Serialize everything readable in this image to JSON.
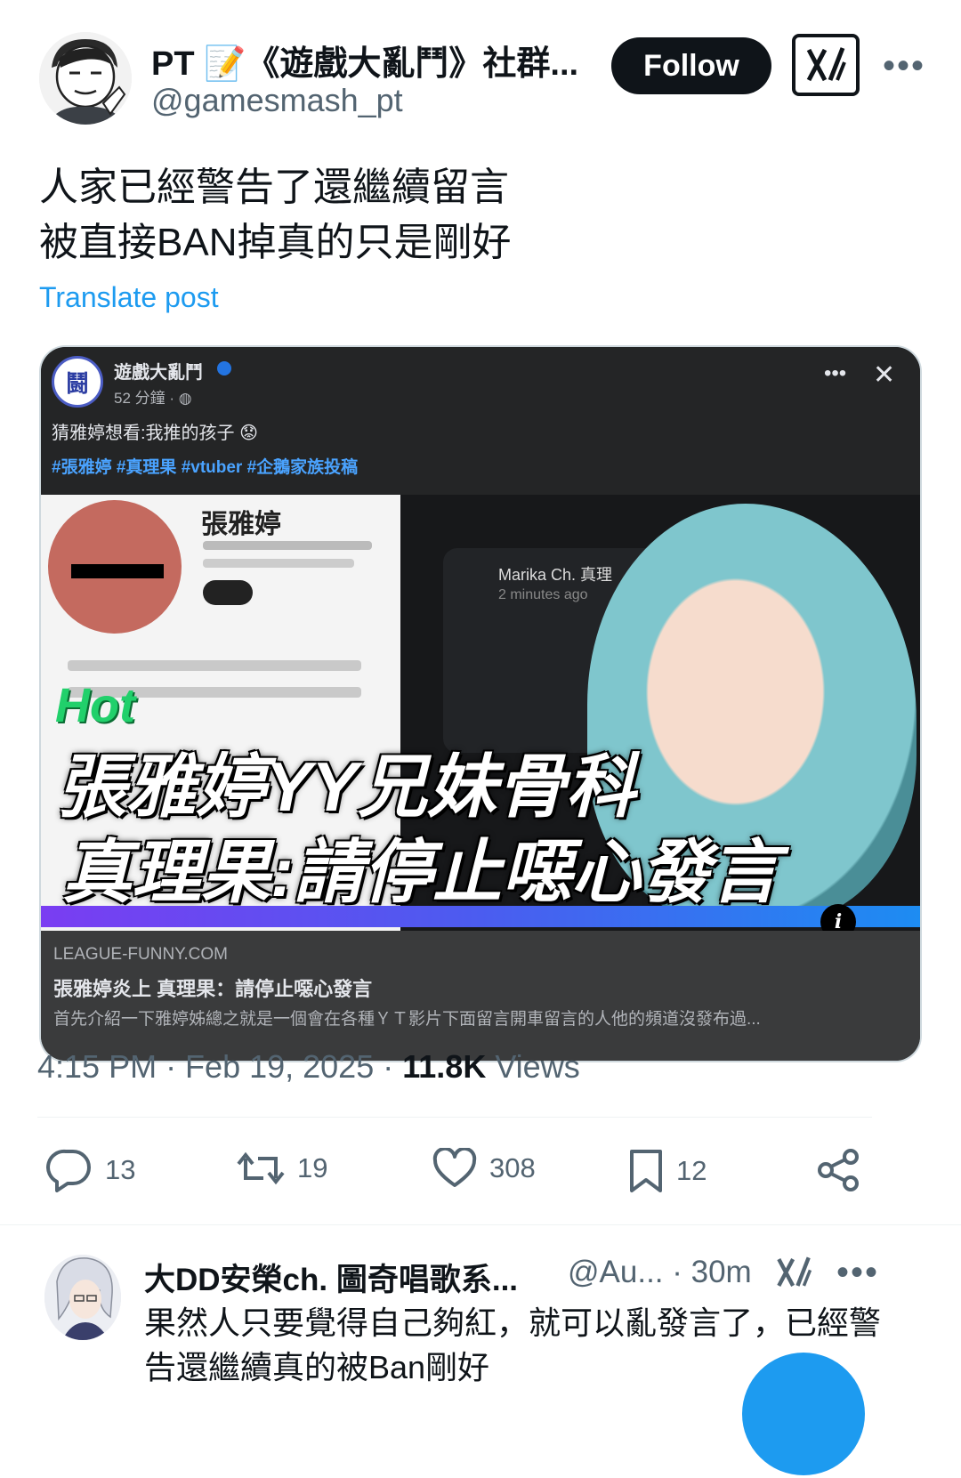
{
  "post": {
    "author_name": "PT 📝《遊戲大亂鬥》社群...",
    "author_handle": "@gamesmash_pt",
    "follow_label": "Follow",
    "more_label": "•••",
    "text": "人家已經警告了還繼續留言\n被直接BAN掉真的只是剛好",
    "translate_label": "Translate post",
    "timestamp": "4:15 PM · Feb 19, 2025 · ",
    "views_count": "11.8K",
    "views_label": " Views"
  },
  "embed": {
    "page_name": "遊戲大亂鬥",
    "page_time": "52 分鐘 · ",
    "logo_glyph": "鬪",
    "more_label": "•••",
    "close_label": "✕",
    "caption": "猜雅婷想看:我推的孩子",
    "hashtags": "#張雅婷 #真理果 #vtuber #企鵝家族投稿",
    "thumb_name": "張雅婷",
    "thumb_marika_name": "Marika Ch. 真理",
    "thumb_marika_ago": "2 minutes ago",
    "thumb_hot": "Hot",
    "thumb_headline1": "張雅婷YY兄妹骨科",
    "thumb_headline2": "真理果:請停止噁心發言",
    "info_label": "i",
    "domain": "LEAGUE-FUNNY.COM",
    "link_title": "張雅婷炎上 真理果：請停止噁心發言",
    "link_desc": "首先介紹一下雅婷姊總之就是一個會在各種ＹＴ影片下面留言開車留言的人他的頻道沒發布過..."
  },
  "actions": {
    "replies": "13",
    "reposts": "19",
    "likes": "308",
    "bookmarks": "12"
  },
  "reply": {
    "author_name": "大DD安榮ch. 圖奇唱歌系...",
    "meta": "@Au... · 30m",
    "more_label": "•••",
    "text": "果然人只要覺得自己夠紅，就可以亂發言了，已經警告還繼續真的被Ban剛好"
  },
  "colors": {
    "accent": "#1d9bf0",
    "text": "#0f1419",
    "muted": "#536471",
    "follow_bg": "#0f1419"
  },
  "icons": [
    "grok-icon",
    "more-icon",
    "reply-icon",
    "repost-icon",
    "like-icon",
    "bookmark-icon",
    "share-icon",
    "verified-icon",
    "globe-icon"
  ]
}
